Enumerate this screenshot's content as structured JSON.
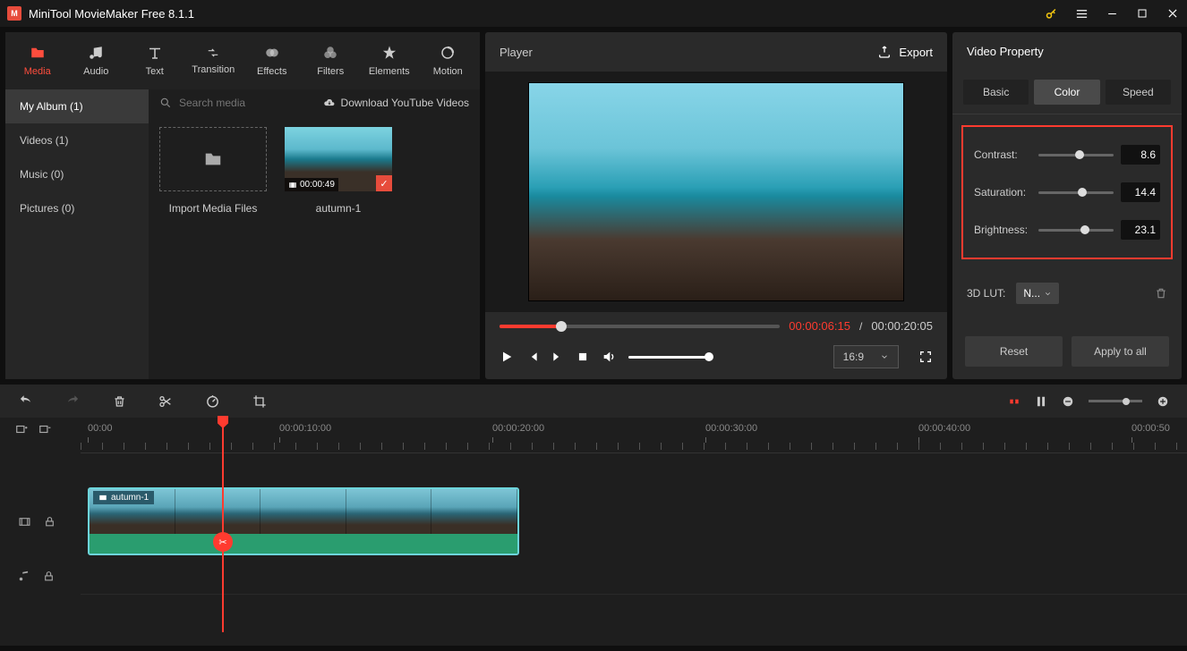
{
  "title": "MiniTool MovieMaker Free 8.1.1",
  "tabs": [
    {
      "label": "Media",
      "icon": "folder"
    },
    {
      "label": "Audio",
      "icon": "music"
    },
    {
      "label": "Text",
      "icon": "text"
    },
    {
      "label": "Transition",
      "icon": "transition"
    },
    {
      "label": "Effects",
      "icon": "effects"
    },
    {
      "label": "Filters",
      "icon": "filters"
    },
    {
      "label": "Elements",
      "icon": "elements"
    },
    {
      "label": "Motion",
      "icon": "motion"
    }
  ],
  "albums": [
    {
      "label": "My Album (1)"
    },
    {
      "label": "Videos (1)"
    },
    {
      "label": "Music (0)"
    },
    {
      "label": "Pictures (0)"
    }
  ],
  "search_placeholder": "Search media",
  "download_yt": "Download YouTube Videos",
  "import_label": "Import Media Files",
  "media_item": {
    "name": "autumn-1",
    "duration": "00:00:49"
  },
  "player": {
    "title": "Player",
    "export": "Export",
    "current": "00:00:06:15",
    "total": "00:00:20:05",
    "sep": " / ",
    "ratio": "16:9"
  },
  "props": {
    "header": "Video Property",
    "tabs": {
      "basic": "Basic",
      "color": "Color",
      "speed": "Speed"
    },
    "contrast": {
      "label": "Contrast:",
      "value": "8.6"
    },
    "saturation": {
      "label": "Saturation:",
      "value": "14.4"
    },
    "brightness": {
      "label": "Brightness:",
      "value": "23.1"
    },
    "lut_label": "3D LUT:",
    "lut_value": "N...",
    "reset": "Reset",
    "apply": "Apply to all"
  },
  "timeline": {
    "ticks": [
      "00:00",
      "00:00:10:00",
      "00:00:20:00",
      "00:00:30:00",
      "00:00:40:00",
      "00:00:50"
    ],
    "clip_label": "autumn-1"
  }
}
